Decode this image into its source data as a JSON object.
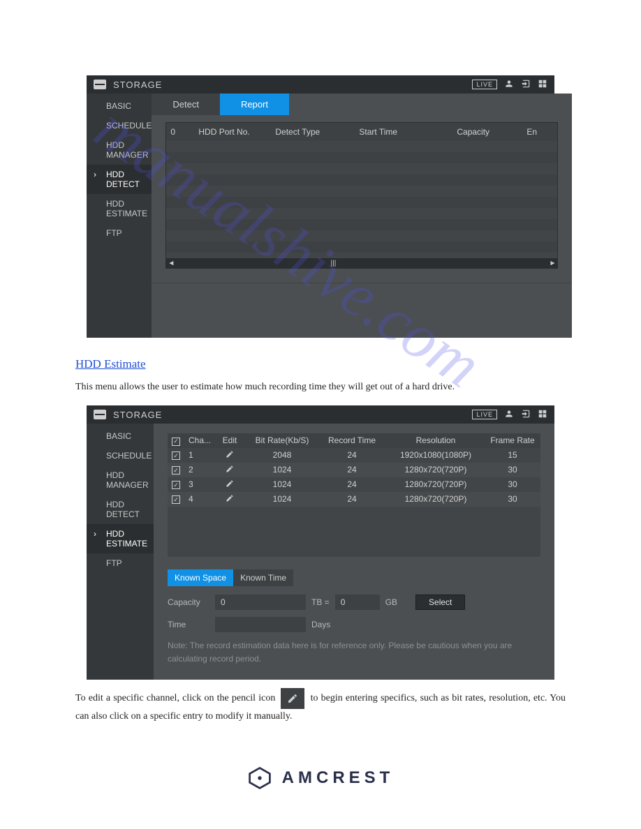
{
  "watermark": "manualshive.com",
  "panel1": {
    "title": "STORAGE",
    "live": "LIVE",
    "sidebar": [
      "BASIC",
      "SCHEDULE",
      "HDD MANAGER",
      "HDD DETECT",
      "HDD ESTIMATE",
      "FTP"
    ],
    "sidebar_active_index": 3,
    "tabs": [
      "Detect",
      "Report"
    ],
    "active_tab_index": 1,
    "report_columns": [
      "0",
      "HDD Port No.",
      "Detect Type",
      "Start Time",
      "Capacity",
      "En"
    ]
  },
  "section_heading": "HDD Estimate",
  "section_text": "This menu allows the user to estimate how much recording time they will get out of a hard drive.",
  "panel2": {
    "title": "STORAGE",
    "live": "LIVE",
    "sidebar": [
      "BASIC",
      "SCHEDULE",
      "HDD MANAGER",
      "HDD DETECT",
      "HDD ESTIMATE",
      "FTP"
    ],
    "sidebar_active_index": 4,
    "table_headers": [
      "",
      "Cha...",
      "Edit",
      "Bit Rate(Kb/S)",
      "Record Time",
      "Resolution",
      "Frame Rate"
    ],
    "rows": [
      {
        "ch": "1",
        "bit": "2048",
        "rec": "24",
        "res": "1920x1080(1080P)",
        "fr": "15"
      },
      {
        "ch": "2",
        "bit": "1024",
        "rec": "24",
        "res": "1280x720(720P)",
        "fr": "30"
      },
      {
        "ch": "3",
        "bit": "1024",
        "rec": "24",
        "res": "1280x720(720P)",
        "fr": "30"
      },
      {
        "ch": "4",
        "bit": "1024",
        "rec": "24",
        "res": "1280x720(720P)",
        "fr": "30"
      }
    ],
    "tabs2": [
      "Known Space",
      "Known Time"
    ],
    "tabs2_active": 0,
    "form": {
      "capacity_label": "Capacity",
      "tb_value": "0",
      "tb_unit": "TB =",
      "gb_value": "0",
      "gb_unit": "GB",
      "select_btn": "Select",
      "time_label": "Time",
      "time_value": "",
      "days_unit": "Days"
    },
    "note": "Note: The record estimation data here is for reference only. Please be cautious when you are calculating record period."
  },
  "after_text_pre": "To edit a specific channel, click on the pencil icon ",
  "after_text_mid": " to begin entering specifics, such as bit rates, resolution, etc. You can also click on a specific entry to modify it manually.",
  "logo_text": "AMCREST"
}
